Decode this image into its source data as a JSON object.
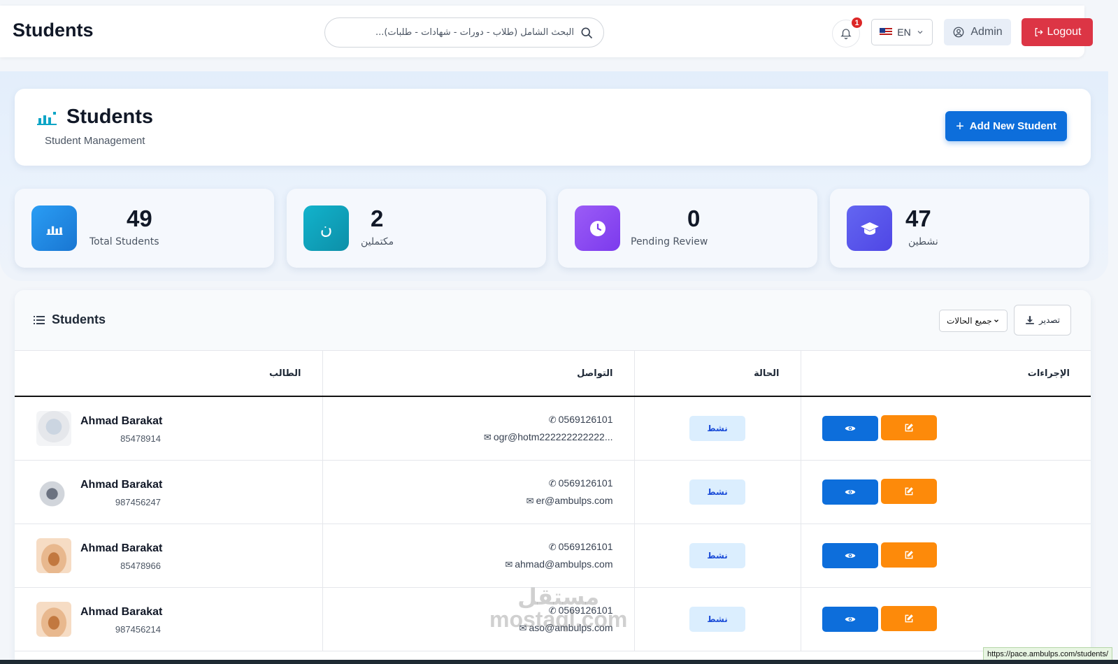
{
  "topbar": {
    "title": "Students",
    "search_placeholder": "البحث الشامل (طلاب - دورات - شهادات - طلبات)...",
    "notification_count": "1",
    "language": "EN",
    "user_label": "Admin",
    "logout_label": "Logout"
  },
  "header": {
    "title": "Students",
    "subtitle": "Student Management",
    "add_button_label": "Add New Student"
  },
  "stats": [
    {
      "value": "49",
      "label": "Total Students",
      "color": "#2196f3",
      "icon": "chart-bar-icon"
    },
    {
      "value": "2",
      "label": "مكتملين",
      "color": "#0fa5c0",
      "icon": "complete-icon"
    },
    {
      "value": "0",
      "label": "Pending Review",
      "color": "#8b4cf6",
      "icon": "clock-icon"
    },
    {
      "value": "47",
      "label": "نشطين",
      "color": "#5b5fe9",
      "icon": "graduation-cap-icon"
    }
  ],
  "table": {
    "title": "Students",
    "filter_value": "جميع الحالات",
    "export_label": "تصدير",
    "columns": [
      "الطالب",
      "التواصل",
      "الحالة",
      "الإجراءات"
    ],
    "rows": [
      {
        "name": "Ahmad Barakat",
        "id": "85478914",
        "phone": "0569126101",
        "email": "ogr@hotm222222222222...",
        "status": "نشط"
      },
      {
        "name": "Ahmad Barakat",
        "id": "987456247",
        "phone": "0569126101",
        "email": "er@ambulps.com",
        "status": "نشط"
      },
      {
        "name": "Ahmad Barakat",
        "id": "85478966",
        "phone": "0569126101",
        "email": "ahmad@ambulps.com",
        "status": "نشط"
      },
      {
        "name": "Ahmad Barakat",
        "id": "987456214",
        "phone": "0569126101",
        "email": "aso@ambulps.com",
        "status": "نشط"
      }
    ]
  },
  "watermark": {
    "line1": "مستقل",
    "line2": "mostaql.com"
  },
  "status_bar_url": "https://pace.ambulps.com/students/"
}
